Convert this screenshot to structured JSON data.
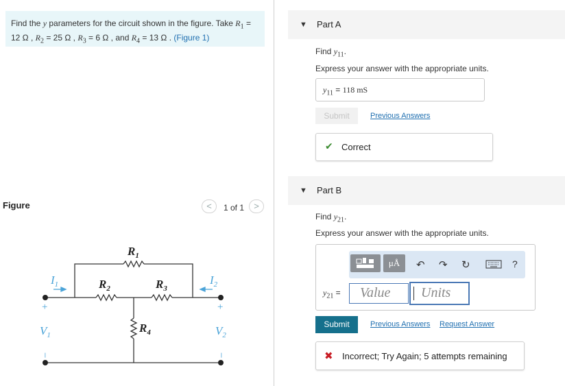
{
  "problem": {
    "line1_prefix": "Find the ",
    "line1_var": "y",
    "line1_mid": " parameters for the circuit shown in the figure. Take ",
    "r1_label": "R",
    "r1_sub": "1",
    "r1_value": " =",
    "line2": "12 Ω , ",
    "r2_label": "R",
    "r2_sub": "2",
    "r2_value": " = 25 Ω , ",
    "r3_label": "R",
    "r3_sub": "3",
    "r3_value": " = 6 Ω , and ",
    "r4_label": "R",
    "r4_sub": "4",
    "r4_value": " = 13 Ω . ",
    "figure_link": "(Figure 1)"
  },
  "figure": {
    "label": "Figure",
    "count": "1 of 1",
    "prev_symbol": "<",
    "next_symbol": ">",
    "circuit": {
      "R1": "R",
      "R1_sub": "1",
      "R2": "R",
      "R2_sub": "2",
      "R3": "R",
      "R3_sub": "3",
      "R4": "R",
      "R4_sub": "4",
      "I1": "I",
      "I1_sub": "1",
      "I2": "I",
      "I2_sub": "2",
      "V1": "V",
      "V1_sub": "1",
      "V2": "V",
      "V2_sub": "2",
      "plus": "+",
      "minus": "−"
    }
  },
  "partA": {
    "title": "Part A",
    "find_prefix": "Find ",
    "find_var": "y",
    "find_sub": "11",
    "find_suffix": ".",
    "instruction": "Express your answer with the appropriate units.",
    "answer_var": "y",
    "answer_sub": "11",
    "answer_eq": " = ",
    "answer_value": "118 mS",
    "submit_label": "Submit",
    "previous_answers": "Previous Answers",
    "feedback": "Correct",
    "feedback_color": "#3a8a2f"
  },
  "partB": {
    "title": "Part B",
    "find_prefix": "Find ",
    "find_var": "y",
    "find_sub": "21",
    "find_suffix": ".",
    "instruction": "Express your answer with the appropriate units.",
    "answer_var": "y",
    "answer_sub": "21",
    "answer_eq": " =",
    "value_placeholder": "Value",
    "units_placeholder": "Units",
    "toolbar": {
      "units_symbol": "μÅ",
      "undo_icon": "undo-icon",
      "redo_icon": "redo-icon",
      "reset_icon": "reset-icon",
      "keyboard_icon": "keyboard-icon",
      "help_symbol": "?"
    },
    "submit_label": "Submit",
    "previous_answers": "Previous Answers",
    "request_answer": "Request Answer",
    "feedback": "Incorrect; Try Again; 5 attempts remaining",
    "feedback_color": "#c81d25",
    "submit_color": "#15708c"
  }
}
